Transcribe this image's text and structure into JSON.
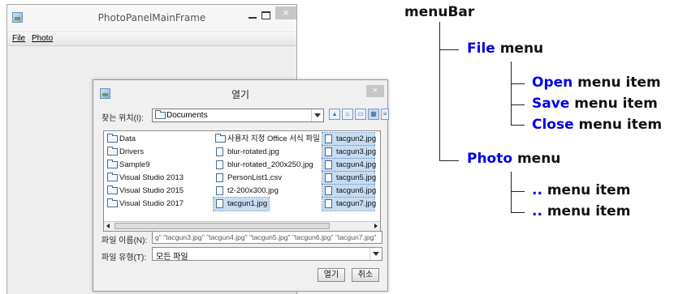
{
  "main_window": {
    "title": "PhotoPanelMainFrame",
    "menus": [
      "File",
      "Photo"
    ]
  },
  "dialog": {
    "title": "열기",
    "close_glyph": "×",
    "look_in_label": "찾는 위치(I):",
    "look_in_value": "Documents",
    "file_columns": [
      [
        {
          "name": "Data",
          "type": "folder"
        },
        {
          "name": "Drivers",
          "type": "folder"
        },
        {
          "name": "Sample9",
          "type": "folder"
        },
        {
          "name": "Visual Studio 2013",
          "type": "folder"
        },
        {
          "name": "Visual Studio 2015",
          "type": "folder"
        },
        {
          "name": "Visual Studio 2017",
          "type": "folder"
        }
      ],
      [
        {
          "name": "사용자 지정 Office 서식 파일",
          "type": "folder"
        },
        {
          "name": "blur-rotated.jpg",
          "type": "file"
        },
        {
          "name": "blur-rotated_200x250.jpg",
          "type": "file"
        },
        {
          "name": "PersonList1.csv",
          "type": "file"
        },
        {
          "name": "t2-200x300.jpg",
          "type": "file"
        },
        {
          "name": "tacgun1.jpg",
          "type": "file",
          "selected": true
        }
      ],
      [
        {
          "name": "tacgun2.jpg",
          "type": "file",
          "selected": true
        },
        {
          "name": "tacgun3.jpg",
          "type": "file",
          "selected": true
        },
        {
          "name": "tacgun4.jpg",
          "type": "file",
          "selected": true
        },
        {
          "name": "tacgun5.jpg",
          "type": "file",
          "selected": true
        },
        {
          "name": "tacgun6.jpg",
          "type": "file",
          "selected": true
        },
        {
          "name": "tacgun7.jpg",
          "type": "file",
          "selected": true
        }
      ]
    ],
    "file_name_label": "파일 이름(N):",
    "file_name_value": "g\" \"tacgun3.jpg\" \"tacgun4.jpg\" \"tacgun5.jpg\" \"tacgun6.jpg\" \"tacgun7.jpg\"",
    "file_type_label": "파일 유형(T):",
    "file_type_value": "모든 파일",
    "open_button": "열기",
    "cancel_button": "취소"
  },
  "tree": {
    "root": "menuBar",
    "file_menu": {
      "keyword": "File",
      "suffix": " menu"
    },
    "file_items": [
      {
        "keyword": "Open",
        "suffix": " menu item"
      },
      {
        "keyword": "Save",
        "suffix": " menu item"
      },
      {
        "keyword": "Close",
        "suffix": " menu item"
      }
    ],
    "photo_menu": {
      "keyword": "Photo",
      "suffix": " menu"
    },
    "photo_items": [
      {
        "keyword": "..",
        "suffix": " menu item"
      },
      {
        "keyword": "..",
        "suffix": " menu item"
      }
    ],
    "keyword_color": "#0000e6"
  }
}
